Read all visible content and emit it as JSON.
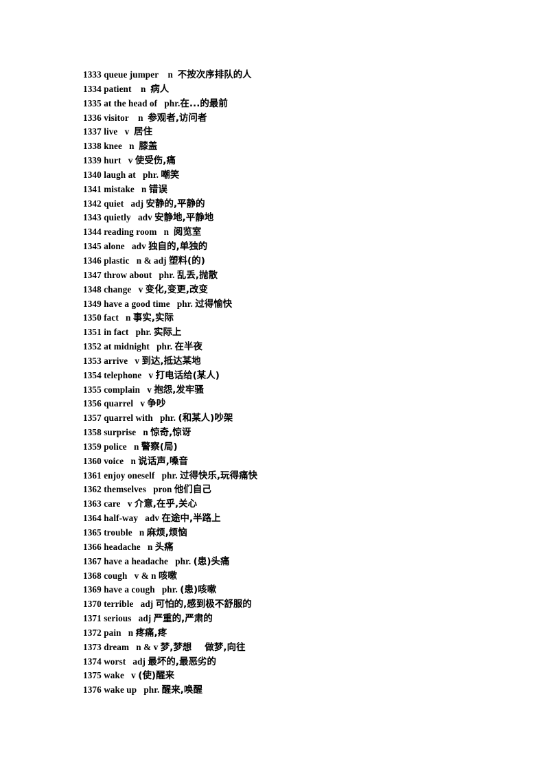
{
  "document": {
    "type": "vocabulary-list",
    "language_pair": "English-Chinese",
    "page_background": "#ffffff",
    "text_color": "#000000",
    "first_entry_number": 1333,
    "last_entry_number": 1376,
    "entry_count": 44
  },
  "entries": [
    {
      "num": "1333",
      "word": "queue jumper",
      "pos": "n",
      "gap_word_pos": "    ",
      "gap_pos_cn": "  ",
      "meaning": "不按次序排队的人"
    },
    {
      "num": "1334",
      "word": "patient",
      "pos": "n",
      "gap_word_pos": "    ",
      "gap_pos_cn": "  ",
      "meaning": "病人"
    },
    {
      "num": "1335",
      "word": "at the head of",
      "pos": "phr.",
      "gap_word_pos": "   ",
      "gap_pos_cn": "",
      "meaning": "在...的最前"
    },
    {
      "num": "1336",
      "word": "visitor",
      "pos": "n",
      "gap_word_pos": "    ",
      "gap_pos_cn": "  ",
      "meaning": "参观者,访问者"
    },
    {
      "num": "1337",
      "word": "live",
      "pos": "v",
      "gap_word_pos": "   ",
      "gap_pos_cn": "  ",
      "meaning": "居住"
    },
    {
      "num": "1338",
      "word": "knee",
      "pos": "n",
      "gap_word_pos": "   ",
      "gap_pos_cn": "  ",
      "meaning": "膝盖"
    },
    {
      "num": "1339",
      "word": "hurt",
      "pos": "v",
      "gap_word_pos": "   ",
      "gap_pos_cn": " ",
      "meaning": "使受伤,痛"
    },
    {
      "num": "1340",
      "word": "laugh at",
      "pos": "phr.",
      "gap_word_pos": "   ",
      "gap_pos_cn": " ",
      "meaning": "嘲笑"
    },
    {
      "num": "1341",
      "word": "mistake",
      "pos": "n",
      "gap_word_pos": "   ",
      "gap_pos_cn": " ",
      "meaning": "错误"
    },
    {
      "num": "1342",
      "word": "quiet",
      "pos": "adj",
      "gap_word_pos": "   ",
      "gap_pos_cn": " ",
      "meaning": "安静的,平静的"
    },
    {
      "num": "1343",
      "word": "quietly",
      "pos": "adv",
      "gap_word_pos": "   ",
      "gap_pos_cn": " ",
      "meaning": "安静地,平静地"
    },
    {
      "num": "1344",
      "word": "reading room",
      "pos": "n",
      "gap_word_pos": "   ",
      "gap_pos_cn": "  ",
      "meaning": "阅览室"
    },
    {
      "num": "1345",
      "word": "alone",
      "pos": "adv",
      "gap_word_pos": "   ",
      "gap_pos_cn": " ",
      "meaning": "独自的,单独的"
    },
    {
      "num": "1346",
      "word": "plastic",
      "pos": "n & adj",
      "gap_word_pos": "   ",
      "gap_pos_cn": " ",
      "meaning": "塑料(的)"
    },
    {
      "num": "1347",
      "word": "throw about",
      "pos": "phr.",
      "gap_word_pos": "   ",
      "gap_pos_cn": " ",
      "meaning": "乱丢,抛散"
    },
    {
      "num": "1348",
      "word": "change",
      "pos": "v",
      "gap_word_pos": "   ",
      "gap_pos_cn": " ",
      "meaning": "变化,变更,改变"
    },
    {
      "num": "1349",
      "word": "have a good time",
      "pos": "phr.",
      "gap_word_pos": "   ",
      "gap_pos_cn": " ",
      "meaning": "过得愉快"
    },
    {
      "num": "1350",
      "word": "fact",
      "pos": "n",
      "gap_word_pos": "   ",
      "gap_pos_cn": " ",
      "meaning": "事实,实际"
    },
    {
      "num": "1351",
      "word": "in fact",
      "pos": "phr.",
      "gap_word_pos": "   ",
      "gap_pos_cn": " ",
      "meaning": "实际上"
    },
    {
      "num": "1352",
      "word": "at midnight",
      "pos": "phr.",
      "gap_word_pos": "   ",
      "gap_pos_cn": " ",
      "meaning": "在半夜"
    },
    {
      "num": "1353",
      "word": "arrive",
      "pos": "v",
      "gap_word_pos": "   ",
      "gap_pos_cn": " ",
      "meaning": "到达,抵达某地"
    },
    {
      "num": "1354",
      "word": "telephone",
      "pos": "v",
      "gap_word_pos": "   ",
      "gap_pos_cn": " ",
      "meaning": "打电话给(某人)"
    },
    {
      "num": "1355",
      "word": "complain",
      "pos": "v",
      "gap_word_pos": "   ",
      "gap_pos_cn": " ",
      "meaning": "抱怨,发牢骚"
    },
    {
      "num": "1356",
      "word": "quarrel",
      "pos": "v",
      "gap_word_pos": "   ",
      "gap_pos_cn": " ",
      "meaning": "争吵"
    },
    {
      "num": "1357",
      "word": "quarrel with",
      "pos": "phr.",
      "gap_word_pos": "   ",
      "gap_pos_cn": " ",
      "meaning": "(和某人)吵架"
    },
    {
      "num": "1358",
      "word": "surprise",
      "pos": "n",
      "gap_word_pos": "   ",
      "gap_pos_cn": " ",
      "meaning": "惊奇,惊讶"
    },
    {
      "num": "1359",
      "word": "police",
      "pos": "n",
      "gap_word_pos": "   ",
      "gap_pos_cn": " ",
      "meaning": "警察(局)"
    },
    {
      "num": "1360",
      "word": "voice",
      "pos": "n",
      "gap_word_pos": "   ",
      "gap_pos_cn": " ",
      "meaning": "说话声,嗓音"
    },
    {
      "num": "1361",
      "word": "enjoy oneself",
      "pos": "phr.",
      "gap_word_pos": "   ",
      "gap_pos_cn": " ",
      "meaning": "过得快乐,玩得痛快"
    },
    {
      "num": "1362",
      "word": "themselves",
      "pos": "pron",
      "gap_word_pos": "   ",
      "gap_pos_cn": " ",
      "meaning": "他们自己"
    },
    {
      "num": "1363",
      "word": "care",
      "pos": "v",
      "gap_word_pos": "   ",
      "gap_pos_cn": " ",
      "meaning": "介意,在乎,关心"
    },
    {
      "num": "1364",
      "word": "half-way",
      "pos": "adv",
      "gap_word_pos": "   ",
      "gap_pos_cn": " ",
      "meaning": "在途中,半路上"
    },
    {
      "num": "1365",
      "word": "trouble",
      "pos": "n",
      "gap_word_pos": "   ",
      "gap_pos_cn": " ",
      "meaning": "麻烦,烦恼"
    },
    {
      "num": "1366",
      "word": "headache",
      "pos": "n",
      "gap_word_pos": "   ",
      "gap_pos_cn": " ",
      "meaning": "头痛"
    },
    {
      "num": "1367",
      "word": "have a headache",
      "pos": "phr.",
      "gap_word_pos": "   ",
      "gap_pos_cn": " ",
      "meaning": "(患)头痛"
    },
    {
      "num": "1368",
      "word": "cough",
      "pos": "v & n",
      "gap_word_pos": "   ",
      "gap_pos_cn": " ",
      "meaning": "咳嗽"
    },
    {
      "num": "1369",
      "word": "have a cough",
      "pos": "phr.",
      "gap_word_pos": "   ",
      "gap_pos_cn": " ",
      "meaning": "(患)咳嗽"
    },
    {
      "num": "1370",
      "word": "terrible",
      "pos": "adj",
      "gap_word_pos": "   ",
      "gap_pos_cn": " ",
      "meaning": "可怕的,感到极不舒服的"
    },
    {
      "num": "1371",
      "word": "serious",
      "pos": "adj",
      "gap_word_pos": "   ",
      "gap_pos_cn": " ",
      "meaning": "严重的,严肃的"
    },
    {
      "num": "1372",
      "word": "pain",
      "pos": "n",
      "gap_word_pos": "   ",
      "gap_pos_cn": " ",
      "meaning": "疼痛,疼"
    },
    {
      "num": "1373",
      "word": "dream",
      "pos": "n & v",
      "gap_word_pos": "   ",
      "gap_pos_cn": " ",
      "meaning": "梦,梦想    做梦,向往"
    },
    {
      "num": "1374",
      "word": "worst",
      "pos": "adj",
      "gap_word_pos": "   ",
      "gap_pos_cn": " ",
      "meaning": "最坏的,最恶劣的"
    },
    {
      "num": "1375",
      "word": "wake",
      "pos": "v",
      "gap_word_pos": "   ",
      "gap_pos_cn": " ",
      "meaning": "(使)醒来"
    },
    {
      "num": "1376",
      "word": "wake up",
      "pos": "phr.",
      "gap_word_pos": "   ",
      "gap_pos_cn": " ",
      "meaning": "醒来,唤醒"
    }
  ]
}
